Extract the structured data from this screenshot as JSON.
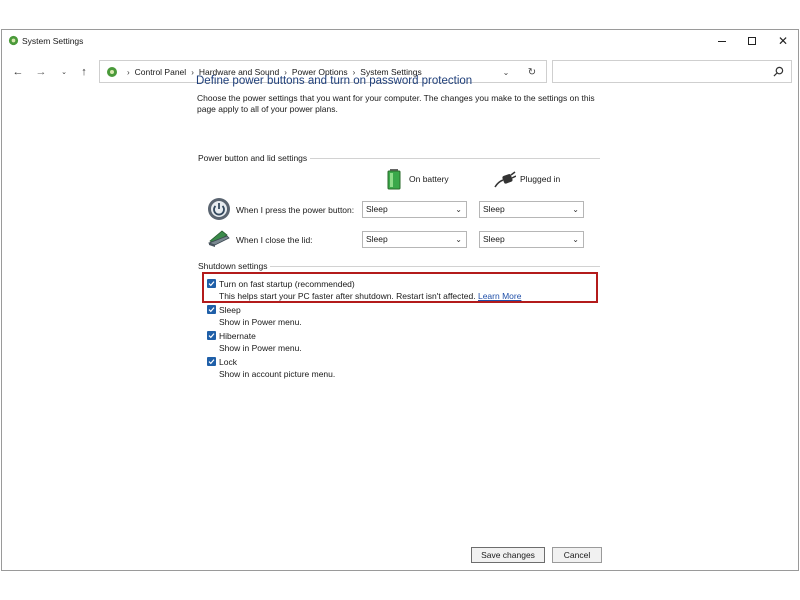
{
  "window": {
    "title": "System Settings"
  },
  "address": {
    "crumbs": [
      "Control Panel",
      "Hardware and Sound",
      "Power Options",
      "System Settings"
    ],
    "separator": "›"
  },
  "search": {
    "placeholder": "",
    "value": ""
  },
  "page": {
    "heading": "Define power buttons and turn on password protection",
    "description": "Choose the power settings that you want for your computer. The changes you make to the settings on this page apply to all of your power plans."
  },
  "power_section": {
    "label": "Power button and lid settings",
    "columns": {
      "battery": "On battery",
      "plugged": "Plugged in"
    },
    "rows": [
      {
        "label": "When I press the power button:",
        "battery": "Sleep",
        "plugged": "Sleep",
        "icon": "power-button-icon"
      },
      {
        "label": "When I close the lid:",
        "battery": "Sleep",
        "plugged": "Sleep",
        "icon": "laptop-lid-icon"
      }
    ]
  },
  "shutdown_section": {
    "label": "Shutdown settings",
    "items": [
      {
        "title": "Turn on fast startup (recommended)",
        "sub": "This helps start your PC faster after shutdown. Restart isn't affected.",
        "link": "Learn More",
        "checked": true
      },
      {
        "title": "Sleep",
        "sub": "Show in Power menu.",
        "checked": true
      },
      {
        "title": "Hibernate",
        "sub": "Show in Power menu.",
        "checked": true
      },
      {
        "title": "Lock",
        "sub": "Show in account picture menu.",
        "checked": true
      }
    ]
  },
  "buttons": {
    "save": "Save changes",
    "cancel": "Cancel"
  },
  "colors": {
    "heading": "#1f3f7a",
    "checkbox": "#1f5fa8",
    "highlight": "#b31b1b",
    "link": "#1f4fa8"
  }
}
